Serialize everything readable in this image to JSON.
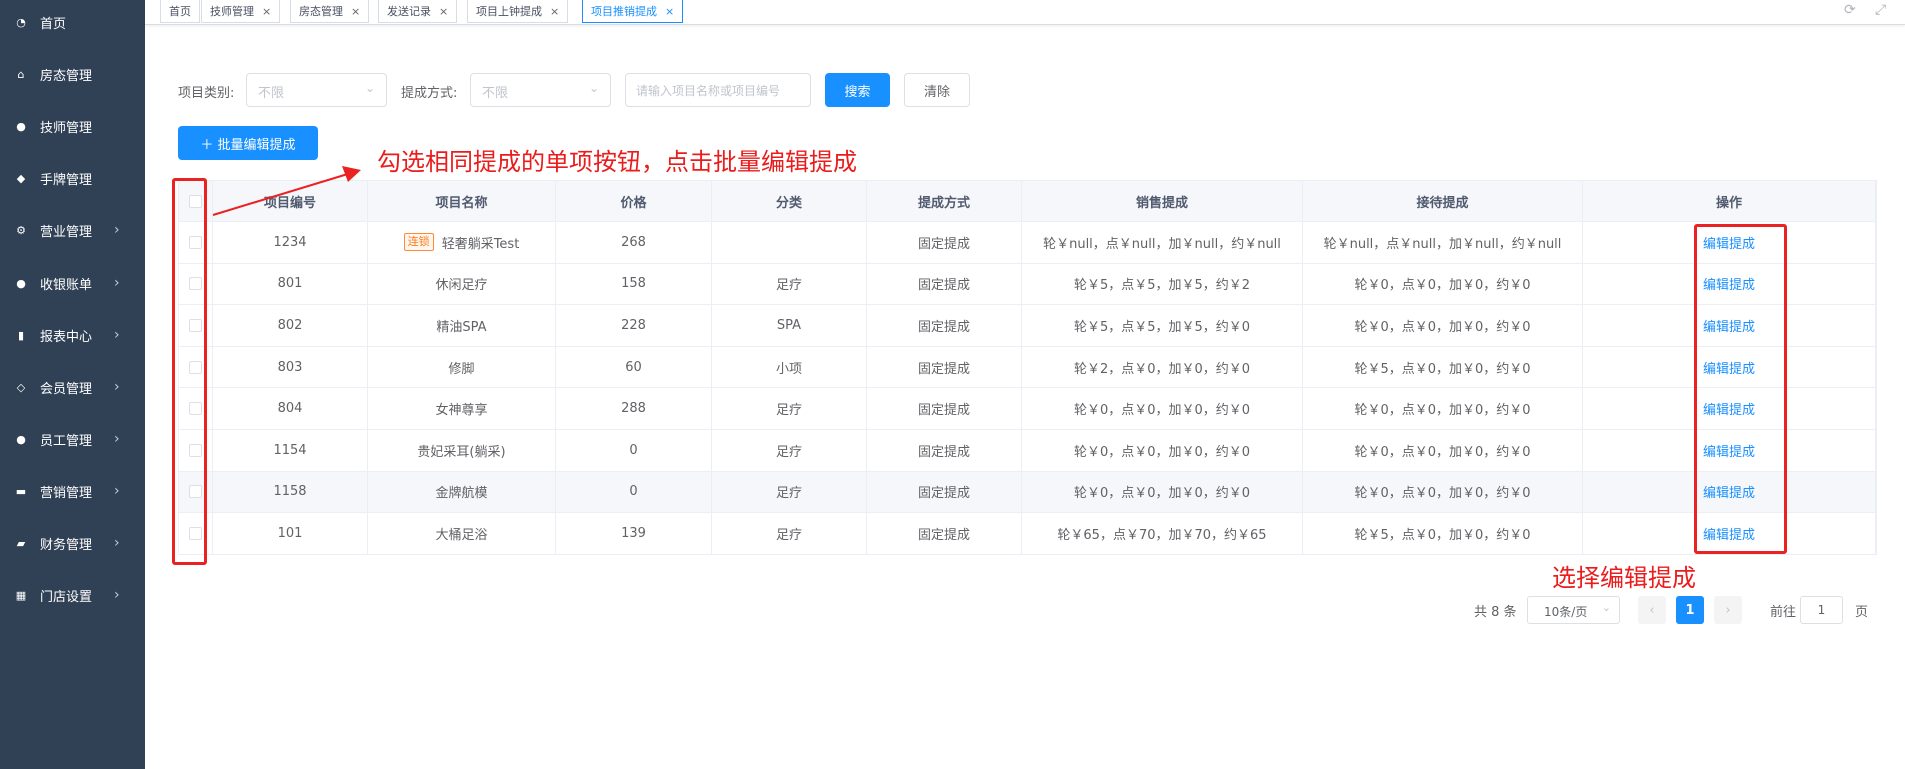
{
  "sidebar": {
    "items": [
      {
        "label": "首页",
        "icon": "dashboard-icon",
        "glyph": "◔",
        "arrow": false
      },
      {
        "label": "房态管理",
        "icon": "home-icon",
        "glyph": "⌂",
        "arrow": false
      },
      {
        "label": "技师管理",
        "icon": "user-icon",
        "glyph": "●",
        "arrow": false
      },
      {
        "label": "手牌管理",
        "icon": "tag-icon",
        "glyph": "◆",
        "arrow": false
      },
      {
        "label": "营业管理",
        "icon": "cog-icon",
        "glyph": "⚙",
        "arrow": true
      },
      {
        "label": "收银账单",
        "icon": "money-bag-icon",
        "glyph": "●",
        "arrow": true
      },
      {
        "label": "报表中心",
        "icon": "bar-chart-icon",
        "glyph": "▮",
        "arrow": true
      },
      {
        "label": "会员管理",
        "icon": "diamond-icon",
        "glyph": "◇",
        "arrow": true
      },
      {
        "label": "员工管理",
        "icon": "person-icon",
        "glyph": "●",
        "arrow": true
      },
      {
        "label": "营销管理",
        "icon": "briefcase-icon",
        "glyph": "▬",
        "arrow": true
      },
      {
        "label": "财务管理",
        "icon": "wallet-icon",
        "glyph": "▰",
        "arrow": true
      },
      {
        "label": "门店设置",
        "icon": "grid-icon",
        "glyph": "▦",
        "arrow": true
      }
    ]
  },
  "tabs": [
    {
      "label": "首页",
      "closable": false
    },
    {
      "label": "技师管理",
      "closable": true
    },
    {
      "label": "房态管理",
      "closable": true
    },
    {
      "label": "发送记录",
      "closable": true
    },
    {
      "label": "项目上钟提成",
      "closable": true
    },
    {
      "label": "项目推销提成",
      "closable": true,
      "active": true
    }
  ],
  "filters": {
    "category_label": "项目类别:",
    "category_value": "不限",
    "method_label": "提成方式:",
    "method_value": "不限",
    "search_placeholder": "请输入项目名称或项目编号",
    "search_button": "搜索",
    "clear_button": "清除"
  },
  "batch_button": "＋ 批量编辑提成",
  "table": {
    "headers": [
      "",
      "项目编号",
      "项目名称",
      "价格",
      "分类",
      "提成方式",
      "销售提成",
      "接待提成",
      "操作"
    ],
    "action_label": "编辑提成",
    "rows": [
      {
        "code": "1234",
        "tag": "连锁",
        "name": "轻奢躺采Test",
        "price": "268",
        "category": "",
        "method": "固定提成",
        "sales": "轮￥null，点￥null，加￥null，约￥null",
        "reception": "轮￥null，点￥null，加￥null，约￥null"
      },
      {
        "code": "801",
        "tag": "",
        "name": "休闲足疗",
        "price": "158",
        "category": "足疗",
        "method": "固定提成",
        "sales": "轮￥5，点￥5，加￥5，约￥2",
        "reception": "轮￥0，点￥0，加￥0，约￥0"
      },
      {
        "code": "802",
        "tag": "",
        "name": "精油SPA",
        "price": "228",
        "category": "SPA",
        "method": "固定提成",
        "sales": "轮￥5，点￥5，加￥5，约￥0",
        "reception": "轮￥0，点￥0，加￥0，约￥0"
      },
      {
        "code": "803",
        "tag": "",
        "name": "修脚",
        "price": "60",
        "category": "小项",
        "method": "固定提成",
        "sales": "轮￥2，点￥0，加￥0，约￥0",
        "reception": "轮￥5，点￥0，加￥0，约￥0"
      },
      {
        "code": "804",
        "tag": "",
        "name": "女神尊享",
        "price": "288",
        "category": "足疗",
        "method": "固定提成",
        "sales": "轮￥0，点￥0，加￥0，约￥0",
        "reception": "轮￥0，点￥0，加￥0，约￥0"
      },
      {
        "code": "1154",
        "tag": "",
        "name": "贵妃采耳(躺采)",
        "price": "0",
        "category": "足疗",
        "method": "固定提成",
        "sales": "轮￥0，点￥0，加￥0，约￥0",
        "reception": "轮￥0，点￥0，加￥0，约￥0"
      },
      {
        "code": "1158",
        "tag": "",
        "name": "金牌航模",
        "price": "0",
        "category": "足疗",
        "method": "固定提成",
        "sales": "轮￥0，点￥0，加￥0，约￥0",
        "reception": "轮￥0，点￥0，加￥0，约￥0"
      },
      {
        "code": "101",
        "tag": "",
        "name": "大桶足浴",
        "price": "139",
        "category": "足疗",
        "method": "固定提成",
        "sales": "轮￥65，点￥70，加￥70，约￥65",
        "reception": "轮￥5，点￥0，加￥0，约￥0"
      }
    ]
  },
  "annotations": {
    "top": "勾选相同提成的单项按钮，点击批量编辑提成",
    "bottom": "选择编辑提成",
    "color": "#ea2222"
  },
  "pagination": {
    "total": "共 8 条",
    "page_size": "10条/页",
    "current_page": "1",
    "goto_label": "前往",
    "goto_value": "1",
    "page_suffix": "页"
  },
  "colors": {
    "sidebar_bg": "#304156",
    "primary": "#1890ff"
  }
}
